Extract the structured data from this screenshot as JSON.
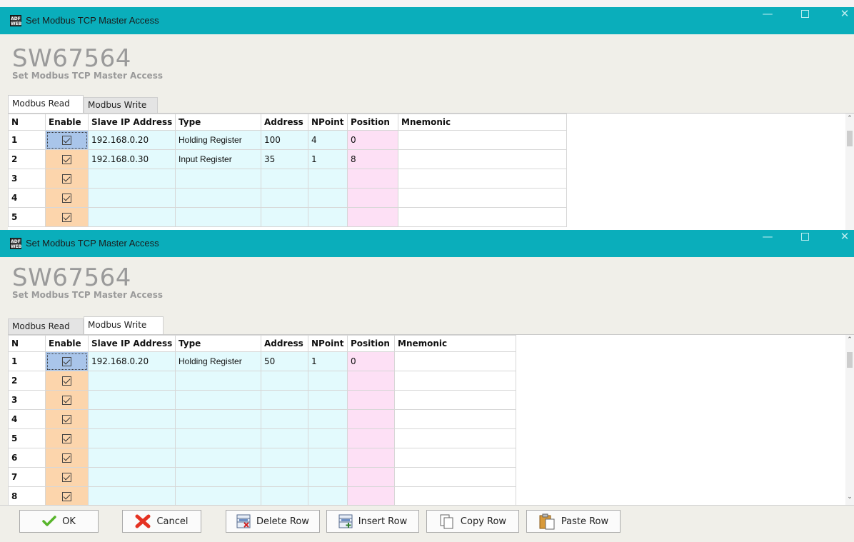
{
  "window1": {
    "title": "Set Modbus TCP Master Access",
    "header_big": "SW67564",
    "header_small": "Set Modbus TCP Master Access",
    "tabs": [
      {
        "label": "Modbus Read",
        "active": true
      },
      {
        "label": "Modbus Write",
        "active": false
      }
    ],
    "columns": [
      "N",
      "Enable",
      "Slave IP Address",
      "Type",
      "Address",
      "NPoint",
      "Position",
      "Mnemonic"
    ],
    "rows": [
      {
        "n": "1",
        "ip": "192.168.0.20",
        "type": "Holding Register",
        "address": "100",
        "npoint": "4",
        "position": "0"
      },
      {
        "n": "2",
        "ip": "192.168.0.30",
        "type": "Input Register",
        "address": "35",
        "npoint": "1",
        "position": "8"
      },
      {
        "n": "3",
        "ip": "",
        "type": "",
        "address": "",
        "npoint": "",
        "position": ""
      },
      {
        "n": "4",
        "ip": "",
        "type": "",
        "address": "",
        "npoint": "",
        "position": ""
      },
      {
        "n": "5",
        "ip": "",
        "type": "",
        "address": "",
        "npoint": "",
        "position": ""
      }
    ]
  },
  "window2": {
    "title": "Set Modbus TCP Master Access",
    "header_big": "SW67564",
    "header_small": "Set Modbus TCP Master Access",
    "tabs": [
      {
        "label": "Modbus Read",
        "active": false
      },
      {
        "label": "Modbus Write",
        "active": true
      }
    ],
    "columns": [
      "N",
      "Enable",
      "Slave IP Address",
      "Type",
      "Address",
      "NPoint",
      "Position",
      "Mnemonic"
    ],
    "rows": [
      {
        "n": "1",
        "ip": "192.168.0.20",
        "type": "Holding Register",
        "address": "50",
        "npoint": "1",
        "position": "0"
      },
      {
        "n": "2",
        "ip": "",
        "type": "",
        "address": "",
        "npoint": "",
        "position": ""
      },
      {
        "n": "3",
        "ip": "",
        "type": "",
        "address": "",
        "npoint": "",
        "position": ""
      },
      {
        "n": "4",
        "ip": "",
        "type": "",
        "address": "",
        "npoint": "",
        "position": ""
      },
      {
        "n": "5",
        "ip": "",
        "type": "",
        "address": "",
        "npoint": "",
        "position": ""
      },
      {
        "n": "6",
        "ip": "",
        "type": "",
        "address": "",
        "npoint": "",
        "position": ""
      },
      {
        "n": "7",
        "ip": "",
        "type": "",
        "address": "",
        "npoint": "",
        "position": ""
      },
      {
        "n": "8",
        "ip": "",
        "type": "",
        "address": "",
        "npoint": "",
        "position": ""
      }
    ]
  },
  "toolbar": {
    "ok_label": "OK",
    "cancel_label": "Cancel",
    "delete_row_label": "Delete Row",
    "insert_row_label": "Insert Row",
    "copy_row_label": "Copy Row",
    "paste_row_label": "Paste Row"
  },
  "colors": {
    "titlebar": "#0aaebb",
    "enable_cell": "#fcd5ac",
    "ip_cell": "#e3fafd",
    "position_cell": "#fde0f5"
  }
}
